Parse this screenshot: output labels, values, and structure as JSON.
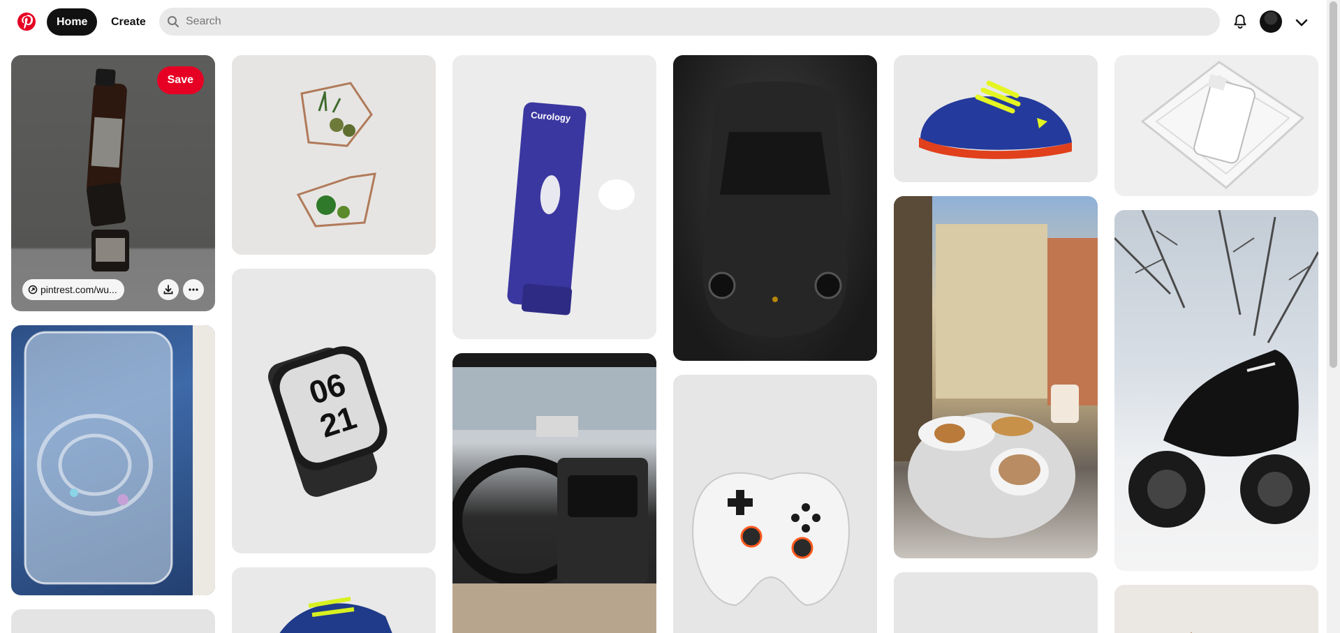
{
  "header": {
    "nav": {
      "home": "Home",
      "create": "Create"
    },
    "search": {
      "placeholder": "Search"
    },
    "brand_color": "#e60023"
  },
  "icons": {
    "logo": "pinterest-logo-icon",
    "search": "search-icon",
    "notifications": "bell-icon",
    "account_menu": "chevron-down-icon"
  },
  "hovered_pin": {
    "save_label": "Save",
    "link_text": "pintrest.com/wu...",
    "actions": [
      "download-icon",
      "more-icon"
    ]
  },
  "pins": [
    {
      "subject": "Hemp seed oil bottle and jars"
    },
    {
      "subject": "Clear phone case"
    },
    {
      "subject": "Geometric wall planters"
    },
    {
      "subject": "Apple Watch Nike edition"
    },
    {
      "subject": "Sneaker"
    },
    {
      "subject": "Curology cleanser tube"
    },
    {
      "subject": "Car interior driving"
    },
    {
      "subject": "Black Porsche 911"
    },
    {
      "subject": "Game controller"
    },
    {
      "subject": "Blue sneaker"
    },
    {
      "subject": "Trevi fountain cafe"
    },
    {
      "subject": "Skincare bottle on glass"
    },
    {
      "subject": "Motorcycle in snow"
    }
  ]
}
